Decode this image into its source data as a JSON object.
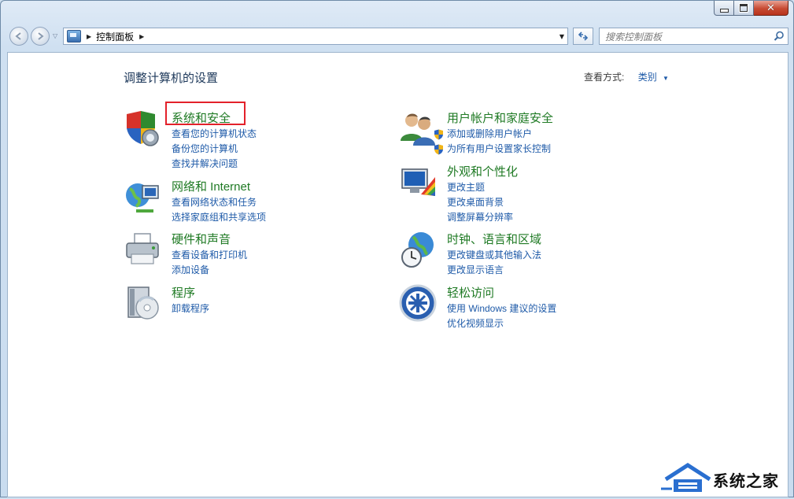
{
  "window": {
    "controls": {
      "minimize": "–",
      "maximize": "□",
      "close": "✕"
    }
  },
  "navbar": {
    "breadcrumb": "控制面板",
    "search_placeholder": "搜索控制面板"
  },
  "main": {
    "heading": "调整计算机的设置",
    "view_by_label": "查看方式:",
    "view_by_value": "类别"
  },
  "categories": [
    {
      "title": "系统和安全",
      "icon": "shield-icon",
      "links": [
        "查看您的计算机状态",
        "备份您的计算机",
        "查找并解决问题"
      ],
      "highlighted": true
    },
    {
      "title": "网络和 Internet",
      "icon": "network-globe-icon",
      "links": [
        "查看网络状态和任务",
        "选择家庭组和共享选项"
      ]
    },
    {
      "title": "硬件和声音",
      "icon": "printer-icon",
      "links": [
        "查看设备和打印机",
        "添加设备"
      ]
    },
    {
      "title": "程序",
      "icon": "programs-disc-icon",
      "links": [
        "卸载程序"
      ]
    },
    {
      "title": "用户帐户和家庭安全",
      "icon": "users-icon",
      "links": [
        "添加或删除用户帐户",
        "为所有用户设置家长控制"
      ],
      "link_icons": [
        "uac-shield-icon",
        "uac-shield-icon"
      ]
    },
    {
      "title": "外观和个性化",
      "icon": "monitor-palette-icon",
      "links": [
        "更改主题",
        "更改桌面背景",
        "调整屏幕分辨率"
      ]
    },
    {
      "title": "时钟、语言和区域",
      "icon": "clock-globe-icon",
      "links": [
        "更改键盘或其他输入法",
        "更改显示语言"
      ]
    },
    {
      "title": "轻松访问",
      "icon": "ease-of-access-icon",
      "links": [
        "使用 Windows 建议的设置",
        "优化视频显示"
      ]
    }
  ],
  "watermark": {
    "text": "系统之家"
  },
  "colors": {
    "category_title": "#1f7a24",
    "link": "#1e5aa8",
    "highlight_border": "#e3212a"
  }
}
